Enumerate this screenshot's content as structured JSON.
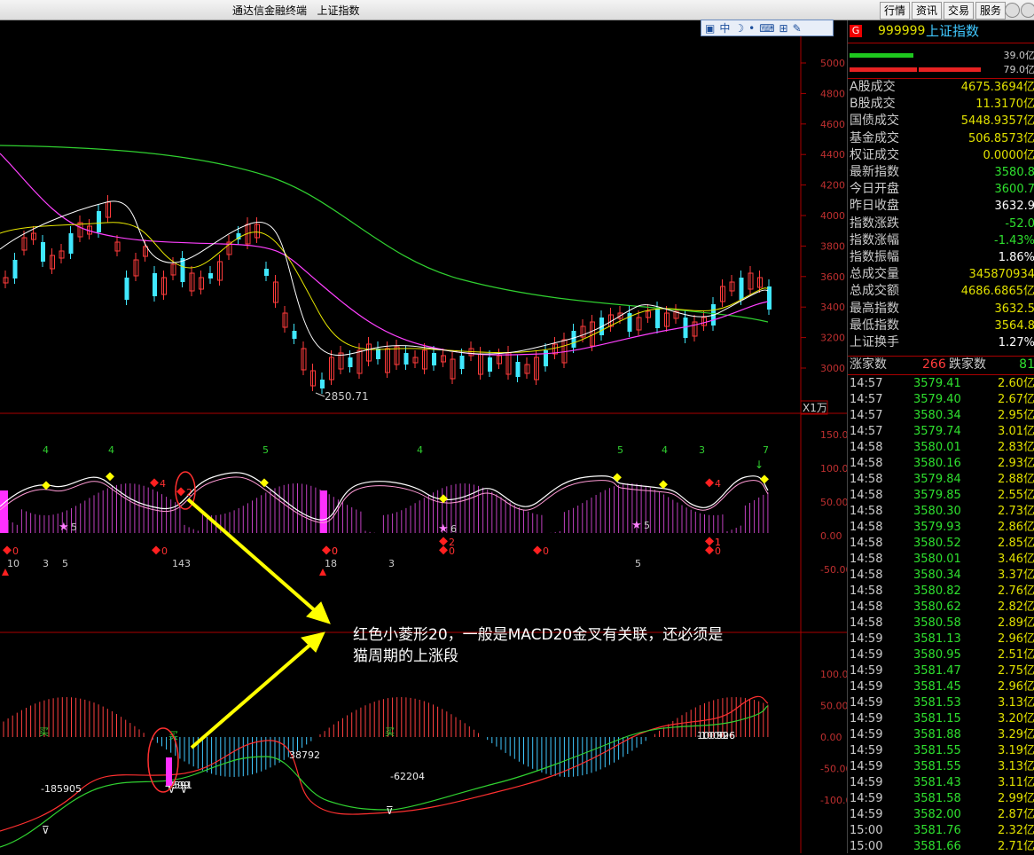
{
  "app": {
    "title": "通达信金融终端",
    "instrument_title": "上证指数"
  },
  "menu": [
    "行情",
    "资讯",
    "交易",
    "服务"
  ],
  "toolbar_icons": [
    "zoom-icon",
    "chinese-input-icon",
    "moon-icon",
    "dot-icon",
    "keyboard-icon",
    "function-icon",
    "wrench-icon"
  ],
  "price_axis": [
    "5000",
    "4800",
    "4600",
    "4400",
    "4200",
    "4000",
    "3800",
    "3600",
    "3400",
    "3200",
    "3000"
  ],
  "low_label": "2850.71",
  "volume_unit": "X1万",
  "indicator_axis": [
    "150.0",
    "100.0",
    "50.00",
    "0.00",
    "-50.00"
  ],
  "macd_axis": [
    "100.0",
    "50.00",
    "0.00",
    "-50.00",
    "-100.0"
  ],
  "indicator_labels": {
    "top": [
      "4",
      "4",
      "5",
      "4",
      "5",
      "4",
      "3",
      "7"
    ],
    "left_small": [
      "10",
      "3",
      "5",
      "14",
      "3",
      "18",
      "3",
      "5"
    ],
    "diamonds": [
      "0",
      "4",
      "2",
      "0",
      "0",
      "2",
      "1",
      "0",
      "0",
      "4",
      "1",
      "0",
      "0"
    ],
    "stars": [
      "5",
      "6",
      "5"
    ]
  },
  "macd_labels": {
    "values": [
      "-185905",
      "4599",
      "591",
      "38792",
      "-62204",
      "100",
      "926",
      "-1000",
      "596"
    ],
    "signals": [
      "买",
      "买",
      "买"
    ]
  },
  "annotation": {
    "line1": "红色小菱形20，一般是MACD20金叉有关联，还必须是",
    "line2": "猫周期的上涨段"
  },
  "panel": {
    "badge": "G",
    "code": "999999",
    "name": "上证指数",
    "bar_values": [
      "39.0亿",
      "79.0亿"
    ],
    "stats": [
      {
        "label": "A股成交",
        "value": "4675.3694亿"
      },
      {
        "label": "B股成交",
        "value": "11.3170亿"
      },
      {
        "label": "国债成交",
        "value": "5448.9357亿"
      },
      {
        "label": "基金成交",
        "value": "506.8573亿"
      },
      {
        "label": "权证成交",
        "value": "0.0000亿"
      },
      {
        "label": "最新指数",
        "value": "3580.8"
      },
      {
        "label": "今日开盘",
        "value": "3600.7"
      },
      {
        "label": "昨日收盘",
        "value": "3632.9"
      },
      {
        "label": "指数涨跌",
        "value": "-52.0"
      },
      {
        "label": "指数涨幅",
        "value": "-1.43%"
      },
      {
        "label": "指数振幅",
        "value": "1.86%"
      },
      {
        "label": "总成交量",
        "value": "345870934"
      },
      {
        "label": "总成交额",
        "value": "4686.6865亿"
      },
      {
        "label": "最高指数",
        "value": "3632.5"
      },
      {
        "label": "最低指数",
        "value": "3564.8"
      },
      {
        "label": "上证换手",
        "value": "1.27%"
      }
    ],
    "up_label": "涨家数",
    "up_count": "266",
    "down_label": "跌家数",
    "down_count": "81",
    "ticks": [
      {
        "time": "14:57",
        "price": "3579.41",
        "vol": "2.60亿"
      },
      {
        "time": "14:57",
        "price": "3579.40",
        "vol": "2.67亿"
      },
      {
        "time": "14:57",
        "price": "3580.34",
        "vol": "2.95亿"
      },
      {
        "time": "14:57",
        "price": "3579.74",
        "vol": "3.01亿"
      },
      {
        "time": "14:58",
        "price": "3580.01",
        "vol": "2.83亿"
      },
      {
        "time": "14:58",
        "price": "3580.16",
        "vol": "2.93亿"
      },
      {
        "time": "14:58",
        "price": "3579.84",
        "vol": "2.88亿"
      },
      {
        "time": "14:58",
        "price": "3579.85",
        "vol": "2.55亿"
      },
      {
        "time": "14:58",
        "price": "3580.30",
        "vol": "2.73亿"
      },
      {
        "time": "14:58",
        "price": "3579.93",
        "vol": "2.86亿"
      },
      {
        "time": "14:58",
        "price": "3580.52",
        "vol": "2.85亿"
      },
      {
        "time": "14:58",
        "price": "3580.01",
        "vol": "3.46亿"
      },
      {
        "time": "14:58",
        "price": "3580.34",
        "vol": "3.37亿"
      },
      {
        "time": "14:58",
        "price": "3580.82",
        "vol": "2.76亿"
      },
      {
        "time": "14:58",
        "price": "3580.62",
        "vol": "2.82亿"
      },
      {
        "time": "14:58",
        "price": "3580.58",
        "vol": "2.89亿"
      },
      {
        "time": "14:59",
        "price": "3581.13",
        "vol": "2.96亿"
      },
      {
        "time": "14:59",
        "price": "3580.95",
        "vol": "2.51亿"
      },
      {
        "time": "14:59",
        "price": "3581.47",
        "vol": "2.75亿"
      },
      {
        "time": "14:59",
        "price": "3581.45",
        "vol": "2.96亿"
      },
      {
        "time": "14:59",
        "price": "3581.53",
        "vol": "3.13亿"
      },
      {
        "time": "14:59",
        "price": "3581.15",
        "vol": "3.20亿"
      },
      {
        "time": "14:59",
        "price": "3581.88",
        "vol": "3.29亿"
      },
      {
        "time": "14:59",
        "price": "3581.55",
        "vol": "3.19亿"
      },
      {
        "time": "14:59",
        "price": "3581.55",
        "vol": "3.13亿"
      },
      {
        "time": "14:59",
        "price": "3581.43",
        "vol": "3.11亿"
      },
      {
        "time": "14:59",
        "price": "3581.58",
        "vol": "2.99亿"
      },
      {
        "time": "14:59",
        "price": "3582.00",
        "vol": "2.87亿"
      },
      {
        "time": "15:00",
        "price": "3581.76",
        "vol": "2.32亿"
      },
      {
        "time": "15:00",
        "price": "3581.66",
        "vol": "2.71亿"
      }
    ]
  },
  "colors": {
    "up": "#ff3b3b",
    "down": "#40e8ff",
    "ma5": "#ffffff",
    "ma10": "#e8e800",
    "ma20": "#ff40ff",
    "ma60": "#30d030",
    "annotation": "#ffff00",
    "panel_price": "#2fe02f"
  }
}
